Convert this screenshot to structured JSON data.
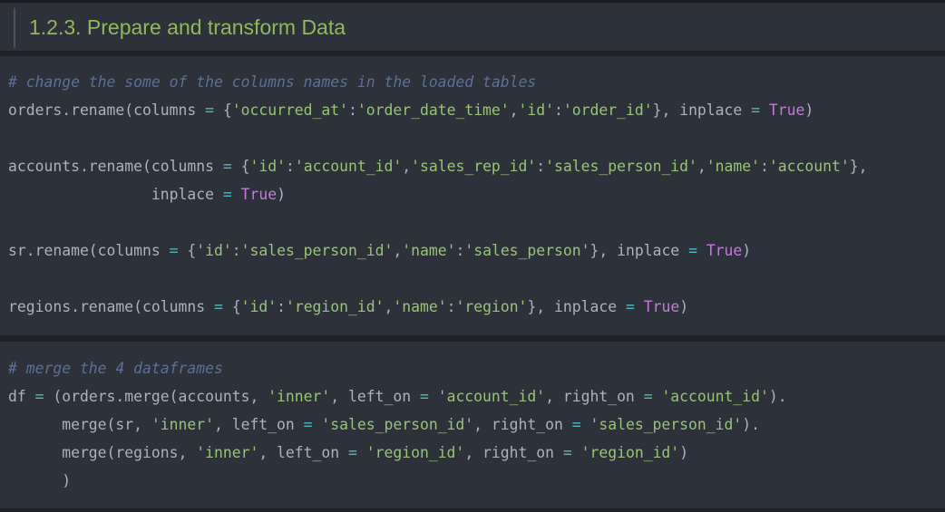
{
  "heading": {
    "title": "1.2.3. Prepare and transform Data"
  },
  "cells": [
    {
      "lines": [
        [
          {
            "t": "cm",
            "v": "# change the some of the columns names in the loaded tables"
          }
        ],
        [
          {
            "t": "nm",
            "v": "orders.rename(columns "
          },
          {
            "t": "op",
            "v": "="
          },
          {
            "t": "nm",
            "v": " {"
          },
          {
            "t": "st",
            "v": "'occurred_at'"
          },
          {
            "t": "nm",
            "v": ":"
          },
          {
            "t": "st",
            "v": "'order_date_time'"
          },
          {
            "t": "nm",
            "v": ","
          },
          {
            "t": "st",
            "v": "'id'"
          },
          {
            "t": "nm",
            "v": ":"
          },
          {
            "t": "st",
            "v": "'order_id'"
          },
          {
            "t": "nm",
            "v": "}, inplace "
          },
          {
            "t": "op",
            "v": "="
          },
          {
            "t": "nm",
            "v": " "
          },
          {
            "t": "kw",
            "v": "True"
          },
          {
            "t": "nm",
            "v": ")"
          }
        ],
        [],
        [
          {
            "t": "nm",
            "v": "accounts.rename(columns "
          },
          {
            "t": "op",
            "v": "="
          },
          {
            "t": "nm",
            "v": " {"
          },
          {
            "t": "st",
            "v": "'id'"
          },
          {
            "t": "nm",
            "v": ":"
          },
          {
            "t": "st",
            "v": "'account_id'"
          },
          {
            "t": "nm",
            "v": ","
          },
          {
            "t": "st",
            "v": "'sales_rep_id'"
          },
          {
            "t": "nm",
            "v": ":"
          },
          {
            "t": "st",
            "v": "'sales_person_id'"
          },
          {
            "t": "nm",
            "v": ","
          },
          {
            "t": "st",
            "v": "'name'"
          },
          {
            "t": "nm",
            "v": ":"
          },
          {
            "t": "st",
            "v": "'account'"
          },
          {
            "t": "nm",
            "v": "},"
          }
        ],
        [
          {
            "t": "nm",
            "v": "                inplace "
          },
          {
            "t": "op",
            "v": "="
          },
          {
            "t": "nm",
            "v": " "
          },
          {
            "t": "kw",
            "v": "True"
          },
          {
            "t": "nm",
            "v": ")"
          }
        ],
        [],
        [
          {
            "t": "nm",
            "v": "sr.rename(columns "
          },
          {
            "t": "op",
            "v": "="
          },
          {
            "t": "nm",
            "v": " {"
          },
          {
            "t": "st",
            "v": "'id'"
          },
          {
            "t": "nm",
            "v": ":"
          },
          {
            "t": "st",
            "v": "'sales_person_id'"
          },
          {
            "t": "nm",
            "v": ","
          },
          {
            "t": "st",
            "v": "'name'"
          },
          {
            "t": "nm",
            "v": ":"
          },
          {
            "t": "st",
            "v": "'sales_person'"
          },
          {
            "t": "nm",
            "v": "}, inplace "
          },
          {
            "t": "op",
            "v": "="
          },
          {
            "t": "nm",
            "v": " "
          },
          {
            "t": "kw",
            "v": "True"
          },
          {
            "t": "nm",
            "v": ")"
          }
        ],
        [],
        [
          {
            "t": "nm",
            "v": "regions.rename(columns "
          },
          {
            "t": "op",
            "v": "="
          },
          {
            "t": "nm",
            "v": " {"
          },
          {
            "t": "st",
            "v": "'id'"
          },
          {
            "t": "nm",
            "v": ":"
          },
          {
            "t": "st",
            "v": "'region_id'"
          },
          {
            "t": "nm",
            "v": ","
          },
          {
            "t": "st",
            "v": "'name'"
          },
          {
            "t": "nm",
            "v": ":"
          },
          {
            "t": "st",
            "v": "'region'"
          },
          {
            "t": "nm",
            "v": "}, inplace "
          },
          {
            "t": "op",
            "v": "="
          },
          {
            "t": "nm",
            "v": " "
          },
          {
            "t": "kw",
            "v": "True"
          },
          {
            "t": "nm",
            "v": ")"
          }
        ]
      ]
    },
    {
      "lines": [
        [
          {
            "t": "cm",
            "v": "# merge the 4 dataframes"
          }
        ],
        [
          {
            "t": "nm",
            "v": "df "
          },
          {
            "t": "op",
            "v": "="
          },
          {
            "t": "nm",
            "v": " (orders.merge(accounts, "
          },
          {
            "t": "st",
            "v": "'inner'"
          },
          {
            "t": "nm",
            "v": ", left_on "
          },
          {
            "t": "op",
            "v": "="
          },
          {
            "t": "nm",
            "v": " "
          },
          {
            "t": "st",
            "v": "'account_id'"
          },
          {
            "t": "nm",
            "v": ", right_on "
          },
          {
            "t": "op",
            "v": "="
          },
          {
            "t": "nm",
            "v": " "
          },
          {
            "t": "st",
            "v": "'account_id'"
          },
          {
            "t": "nm",
            "v": ")."
          }
        ],
        [
          {
            "t": "nm",
            "v": "      merge(sr, "
          },
          {
            "t": "st",
            "v": "'inner'"
          },
          {
            "t": "nm",
            "v": ", left_on "
          },
          {
            "t": "op",
            "v": "="
          },
          {
            "t": "nm",
            "v": " "
          },
          {
            "t": "st",
            "v": "'sales_person_id'"
          },
          {
            "t": "nm",
            "v": ", right_on "
          },
          {
            "t": "op",
            "v": "="
          },
          {
            "t": "nm",
            "v": " "
          },
          {
            "t": "st",
            "v": "'sales_person_id'"
          },
          {
            "t": "nm",
            "v": ")."
          }
        ],
        [
          {
            "t": "nm",
            "v": "      merge(regions, "
          },
          {
            "t": "st",
            "v": "'inner'"
          },
          {
            "t": "nm",
            "v": ", left_on "
          },
          {
            "t": "op",
            "v": "="
          },
          {
            "t": "nm",
            "v": " "
          },
          {
            "t": "st",
            "v": "'region_id'"
          },
          {
            "t": "nm",
            "v": ", right_on "
          },
          {
            "t": "op",
            "v": "="
          },
          {
            "t": "nm",
            "v": " "
          },
          {
            "t": "st",
            "v": "'region_id'"
          },
          {
            "t": "nm",
            "v": ")"
          }
        ],
        [
          {
            "t": "nm",
            "v": "      )"
          }
        ]
      ]
    }
  ],
  "colors": {
    "comment": "#5c6f99",
    "string": "#98c379",
    "keyword": "#c678dd",
    "operator": "#56b6c2",
    "text": "#abb2bf",
    "heading": "#8fb95a",
    "cell_background": "#2c313a"
  }
}
